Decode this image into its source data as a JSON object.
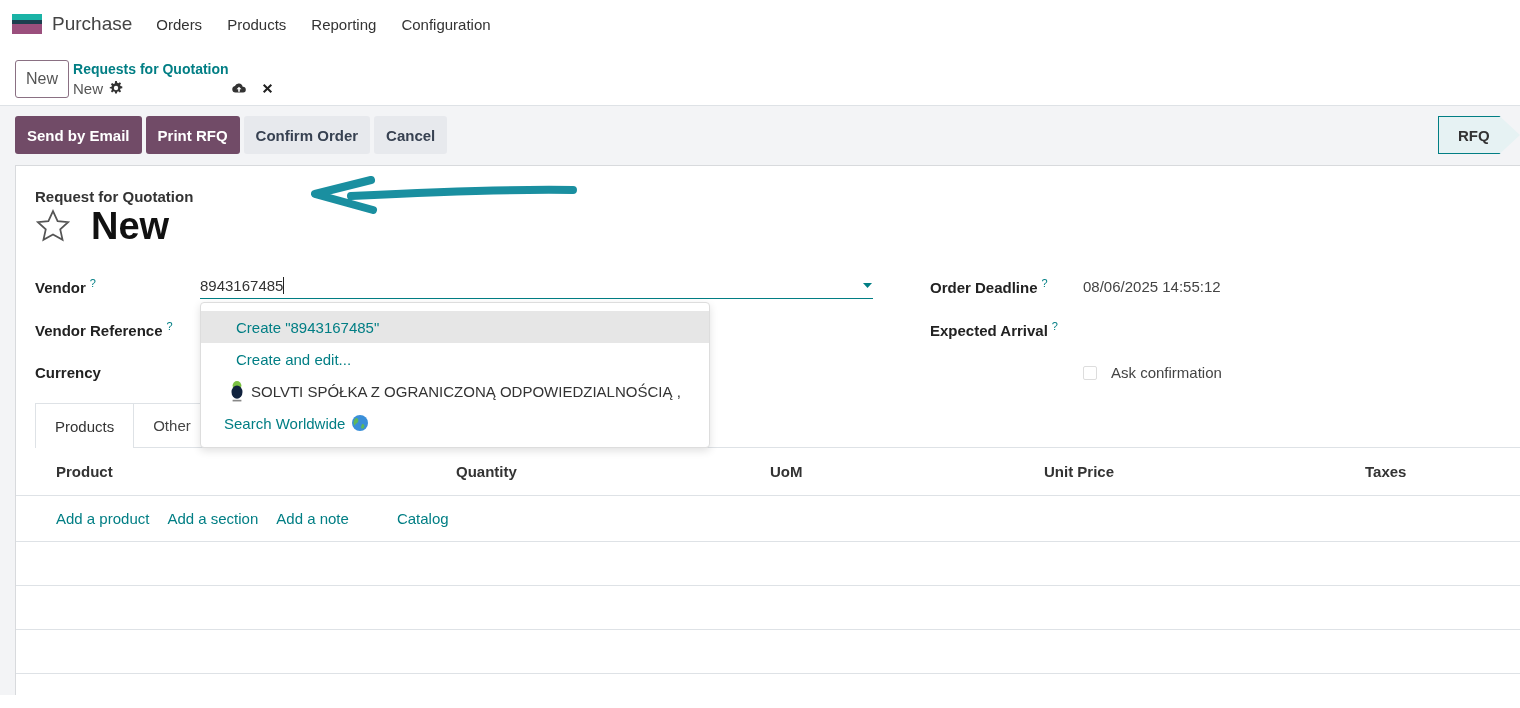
{
  "navbar": {
    "app": "Purchase",
    "menu": [
      "Orders",
      "Products",
      "Reporting",
      "Configuration"
    ]
  },
  "control_panel": {
    "new_button": "New",
    "breadcrumb": "Requests for Quotation",
    "record": "New"
  },
  "actions": [
    {
      "label": "Send by Email",
      "kind": "primary"
    },
    {
      "label": "Print RFQ",
      "kind": "primary"
    },
    {
      "label": "Confirm Order",
      "kind": "secondary"
    },
    {
      "label": "Cancel",
      "kind": "secondary"
    }
  ],
  "status_stages": [
    {
      "label": "RFQ",
      "selected": true
    }
  ],
  "form": {
    "subtitle": "Request for Quotation",
    "title": "New",
    "favorite": false,
    "left_fields": [
      {
        "label": "Vendor",
        "help": "?",
        "value": "8943167485",
        "kind": "input"
      },
      {
        "label": "Vendor Reference",
        "help": "?",
        "kind": "text"
      },
      {
        "label": "Currency",
        "kind": "text"
      }
    ],
    "right_fields": [
      {
        "label": "Order Deadline",
        "help": "?",
        "value": "08/06/2025 14:55:12",
        "kind": "text"
      },
      {
        "label": "Expected Arrival",
        "help": "?",
        "kind": "text"
      },
      {
        "label": "Ask confirmation",
        "kind": "checkbox",
        "checked": false
      }
    ]
  },
  "dropdown": [
    {
      "label": "Create \"8943167485\"",
      "kind": "action",
      "selected": true
    },
    {
      "label": "Create and edit...",
      "kind": "action",
      "selected": false
    },
    {
      "label": "SOLVTI SPÓŁKA Z OGRANICZONĄ ODPOWIEDZIALNOŚCIĄ ,",
      "kind": "partner",
      "selected": false
    },
    {
      "label": "Search Worldwide",
      "kind": "search",
      "selected": false
    }
  ],
  "tabs": [
    {
      "label": "Products",
      "selected": true
    },
    {
      "label": "Other",
      "selected": false
    }
  ],
  "table": {
    "columns": [
      "Product",
      "Quantity",
      "UoM",
      "Unit Price",
      "Taxes"
    ],
    "add_links": [
      "Add a product",
      "Add a section",
      "Add a note",
      "Catalog"
    ]
  }
}
